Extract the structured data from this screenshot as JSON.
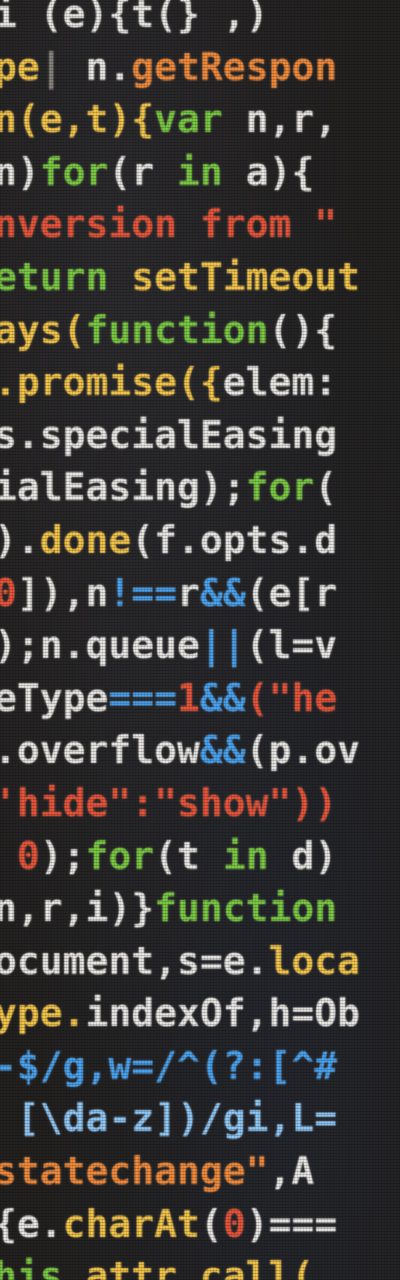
{
  "code_lines": [
    [
      {
        "t": "i (e){t(} ,)",
        "c": "c-white"
      }
    ],
    [
      {
        "t": "pe",
        "c": "c-yellow"
      },
      {
        "t": "|",
        "c": "c-grey"
      },
      {
        "t": " n.",
        "c": "c-white"
      },
      {
        "t": "getRespon",
        "c": "c-orange"
      }
    ],
    [
      {
        "t": "n(e,t){",
        "c": "c-yellow"
      },
      {
        "t": "var",
        "c": "c-green"
      },
      {
        "t": " n,r,",
        "c": "c-white"
      }
    ],
    [
      {
        "t": "n)",
        "c": "c-white"
      },
      {
        "t": "for",
        "c": "c-green"
      },
      {
        "t": "(r ",
        "c": "c-white"
      },
      {
        "t": "in",
        "c": "c-green"
      },
      {
        "t": " a){",
        "c": "c-white"
      }
    ],
    [
      {
        "t": "nversion from \"",
        "c": "c-red"
      }
    ],
    [
      {
        "t": "eturn ",
        "c": "c-green"
      },
      {
        "t": "setTimeout",
        "c": "c-yellow"
      }
    ],
    [
      {
        "t": "ays(",
        "c": "c-yellow"
      },
      {
        "t": "function",
        "c": "c-green"
      },
      {
        "t": "(){",
        "c": "c-white"
      }
    ],
    [
      {
        "t": ".promise({",
        "c": "c-yellow"
      },
      {
        "t": "elem:",
        "c": "c-white"
      }
    ],
    [
      {
        "t": "s.specialEasing",
        "c": "c-white"
      }
    ],
    [
      {
        "t": "ialEasing);",
        "c": "c-white"
      },
      {
        "t": "for",
        "c": "c-green"
      },
      {
        "t": "(",
        "c": "c-white"
      }
    ],
    [
      {
        "t": ").",
        "c": "c-white"
      },
      {
        "t": "done",
        "c": "c-yellow"
      },
      {
        "t": "(f.opts.d",
        "c": "c-white"
      }
    ],
    [
      {
        "t": "0",
        "c": "c-red"
      },
      {
        "t": "]),n",
        "c": "c-white"
      },
      {
        "t": "!==",
        "c": "c-blue"
      },
      {
        "t": "r",
        "c": "c-white"
      },
      {
        "t": "&&",
        "c": "c-blue"
      },
      {
        "t": "(e[r",
        "c": "c-white"
      }
    ],
    [
      {
        "t": ");n.queue",
        "c": "c-white"
      },
      {
        "t": "||",
        "c": "c-blue"
      },
      {
        "t": "(l=v",
        "c": "c-white"
      }
    ],
    [
      {
        "t": "eType",
        "c": "c-white"
      },
      {
        "t": "===",
        "c": "c-blue"
      },
      {
        "t": "1",
        "c": "c-red"
      },
      {
        "t": "&&",
        "c": "c-blue"
      },
      {
        "t": "(\"he",
        "c": "c-red"
      }
    ],
    [
      {
        "t": ".overflow",
        "c": "c-white"
      },
      {
        "t": "&&",
        "c": "c-blue"
      },
      {
        "t": "(p.ov",
        "c": "c-white"
      }
    ],
    [
      {
        "t": "'hide\":\"show\"))",
        "c": "c-red"
      }
    ],
    [
      {
        "t": " 0",
        "c": "c-red"
      },
      {
        "t": ");",
        "c": "c-white"
      },
      {
        "t": "for",
        "c": "c-green"
      },
      {
        "t": "(t ",
        "c": "c-white"
      },
      {
        "t": "in",
        "c": "c-green"
      },
      {
        "t": " d)",
        "c": "c-white"
      }
    ],
    [
      {
        "t": "n,r,i)}",
        "c": "c-white"
      },
      {
        "t": "function",
        "c": "c-green"
      }
    ],
    [
      {
        "t": "ocument,s=e.",
        "c": "c-white"
      },
      {
        "t": "loca",
        "c": "c-yellow"
      }
    ],
    [
      {
        "t": "ype.",
        "c": "c-yellow"
      },
      {
        "t": "indexOf",
        "c": "c-white"
      },
      {
        "t": ",h=Ob",
        "c": "c-white"
      }
    ],
    [
      {
        "t": "-$/g,w=/^(?:[^#",
        "c": "c-blue"
      }
    ],
    [
      {
        "t": " [\\da-z])/gi,L=",
        "c": "c-lblue"
      }
    ],
    [
      {
        "t": "statechange\"",
        "c": "c-orange"
      },
      {
        "t": ",A",
        "c": "c-white"
      }
    ],
    [
      {
        "t": "{e.",
        "c": "c-white"
      },
      {
        "t": "charAt",
        "c": "c-yellow"
      },
      {
        "t": "(",
        "c": "c-white"
      },
      {
        "t": "0",
        "c": "c-red"
      },
      {
        "t": ")===",
        "c": "c-white"
      }
    ],
    [
      {
        "t": "his.",
        "c": "c-green"
      },
      {
        "t": "attr.call(",
        "c": "c-yellow"
      }
    ]
  ]
}
